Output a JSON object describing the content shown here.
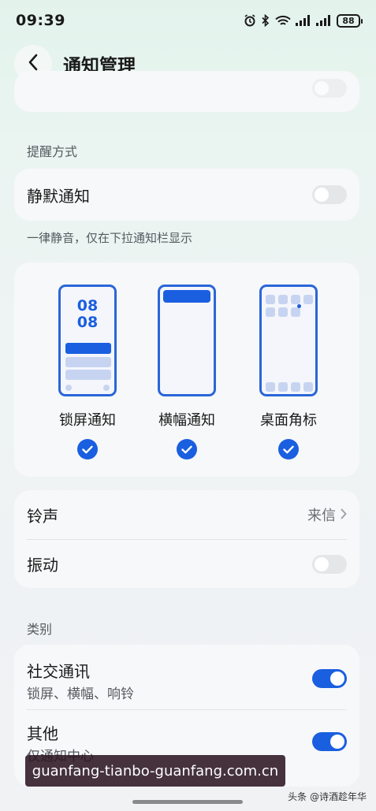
{
  "status_bar": {
    "time": "09:39",
    "battery": "88"
  },
  "header": {
    "title": "通知管理"
  },
  "reminder": {
    "section_title": "提醒方式",
    "silent_label": "静默通知",
    "silent_desc": "一律静音，仅在下拉通知栏显示"
  },
  "styles": [
    {
      "label": "锁屏通知",
      "clock_top": "08",
      "clock_bottom": "08"
    },
    {
      "label": "横幅通知"
    },
    {
      "label": "桌面角标"
    }
  ],
  "sound": {
    "ringtone_label": "铃声",
    "ringtone_value": "来信",
    "vibration_label": "振动"
  },
  "categories": {
    "section_title": "类别",
    "items": [
      {
        "label": "社交通讯",
        "sub": "锁屏、横幅、响铃"
      },
      {
        "label": "其他",
        "sub": "仅通知中心"
      }
    ]
  },
  "watermark": "guanfang-tianbo-guanfang.com.cn",
  "source": "头条 @诗酒趁年华",
  "colors": {
    "accent": "#1a5fe0",
    "frame": "#2a66d9"
  }
}
